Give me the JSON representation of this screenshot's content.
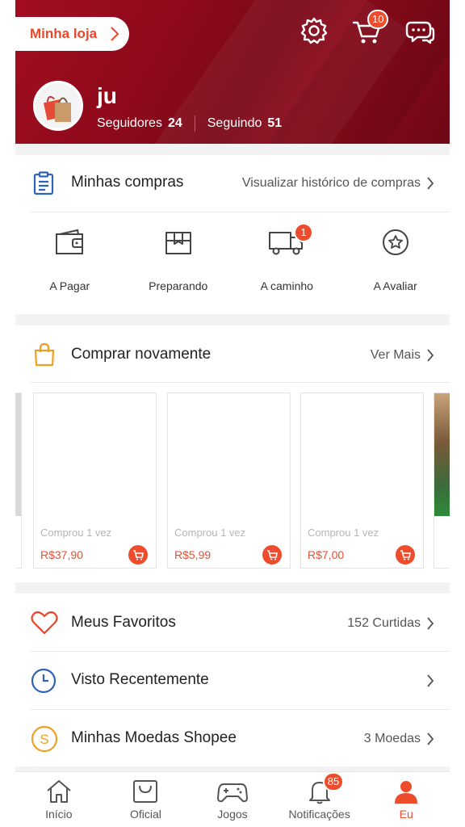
{
  "header": {
    "my_shop_label": "Minha loja",
    "cart_badge": "10",
    "username": "ju",
    "followers_label": "Seguidores",
    "followers_count": "24",
    "following_label": "Seguindo",
    "following_count": "51",
    "icons": [
      "settings-icon",
      "cart-icon",
      "chat-icon"
    ]
  },
  "purchases": {
    "title": "Minhas compras",
    "history_link": "Visualizar histórico de compras",
    "statuses": [
      {
        "label": "A Pagar",
        "icon": "wallet-icon"
      },
      {
        "label": "Preparando",
        "icon": "box-icon"
      },
      {
        "label": "A caminho",
        "icon": "truck-icon",
        "badge": "1"
      },
      {
        "label": "A Avaliar",
        "icon": "star-icon"
      }
    ]
  },
  "buy_again": {
    "title": "Comprar novamente",
    "see_more": "Ver Mais",
    "products": [
      {
        "bought": "Comprou 1 vez",
        "price": "R$37,90"
      },
      {
        "bought": "Comprou 1 vez",
        "price": "R$5,99"
      },
      {
        "bought": "Comprou 1 vez",
        "price": "R$7,00"
      }
    ]
  },
  "menu": {
    "favorites": {
      "label": "Meus Favoritos",
      "value": "152 Curtidas"
    },
    "recent": {
      "label": "Visto Recentemente",
      "value": ""
    },
    "coins": {
      "label": "Minhas Moedas Shopee",
      "value": "3 Moedas"
    }
  },
  "bottom_nav": {
    "items": [
      {
        "label": "Início",
        "icon": "home-icon"
      },
      {
        "label": "Oficial",
        "icon": "mall-bag-icon"
      },
      {
        "label": "Jogos",
        "icon": "gamepad-icon"
      },
      {
        "label": "Notificações",
        "icon": "bell-icon",
        "badge": "85"
      },
      {
        "label": "Eu",
        "icon": "user-icon",
        "active": true
      }
    ]
  },
  "colors": {
    "brand": "#ee4d2d",
    "header": "#8c0a1b"
  }
}
